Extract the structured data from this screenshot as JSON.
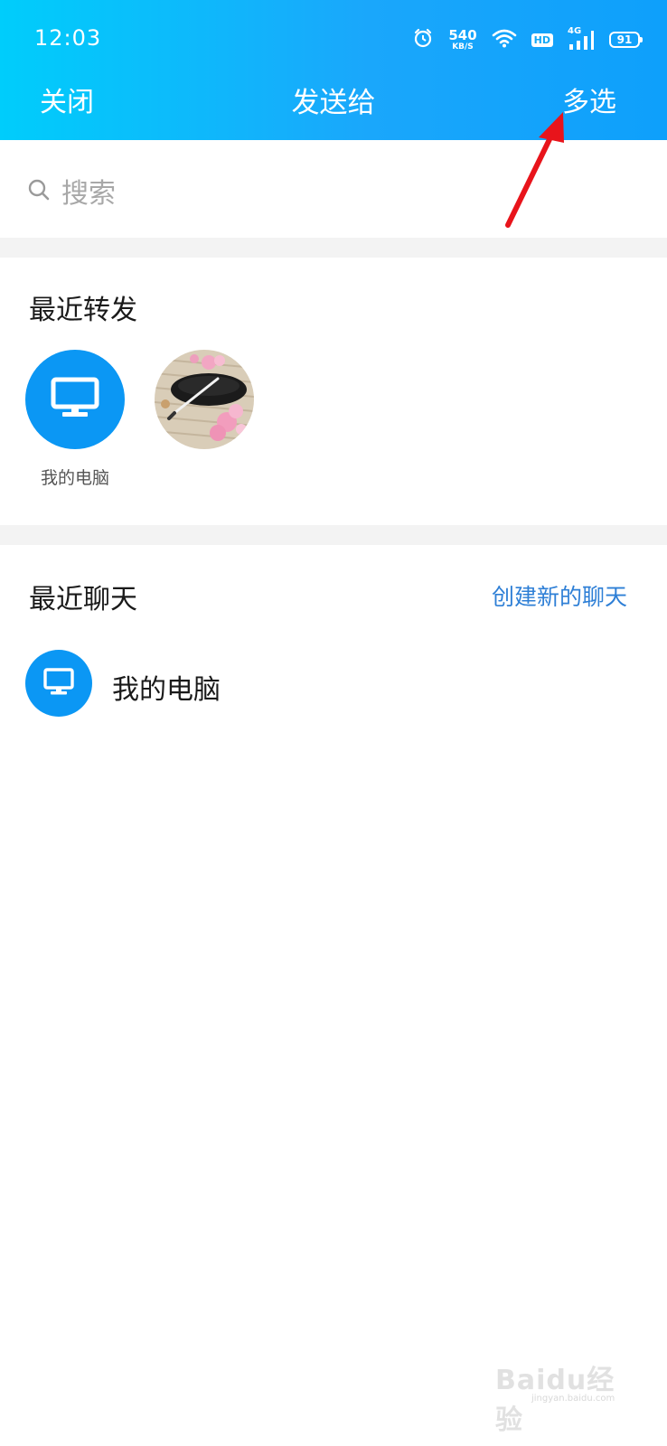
{
  "status_bar": {
    "time": "12:03",
    "net_speed_value": "540",
    "net_speed_unit": "KB/S",
    "hd_label": "HD",
    "network_label": "4G",
    "battery_level": "91",
    "icons": [
      "alarm-icon",
      "wifi-icon",
      "hd-icon",
      "signal-icon",
      "battery-icon"
    ]
  },
  "nav": {
    "close_label": "关闭",
    "title": "发送给",
    "multi_select_label": "多选"
  },
  "search": {
    "placeholder": "搜索"
  },
  "recent_forward": {
    "title": "最近转发",
    "items": [
      {
        "label": "我的电脑",
        "icon": "monitor-icon",
        "color": "#0b97f4"
      },
      {
        "label": "",
        "icon": "photo-avatar"
      }
    ]
  },
  "recent_chats": {
    "title": "最近聊天",
    "create_label": "创建新的聊天",
    "items": [
      {
        "name": "我的电脑",
        "icon": "monitor-icon",
        "color": "#0b97f4"
      }
    ]
  },
  "watermark": {
    "text": "Baidu经验",
    "url": "jingyan.baidu.com"
  },
  "colors": {
    "header_start": "#00cdfb",
    "header_end": "#0ea0fb",
    "accent": "#0b97f4",
    "link": "#2e7fd6",
    "annotation_arrow": "#e8141b"
  }
}
